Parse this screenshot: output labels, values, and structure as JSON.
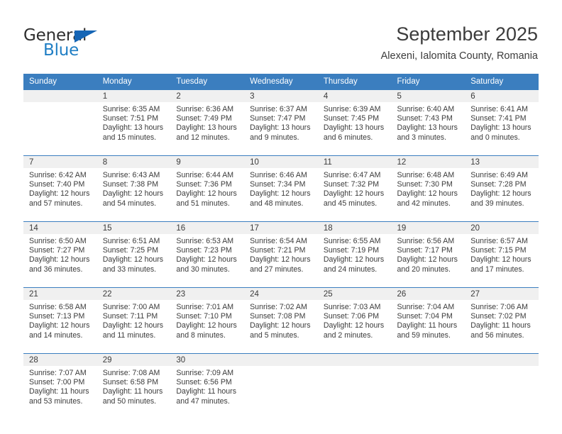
{
  "brand": {
    "name_part1": "General",
    "name_part2": "Blue",
    "accent_color": "#1f7ec4",
    "triangle_color": "#1565b5"
  },
  "header": {
    "title": "September 2025",
    "location": "Alexeni, Ialomita County, Romania"
  },
  "calendar": {
    "header_bg": "#3b7ebf",
    "daynumber_bg": "#f0f0f0",
    "weekdays": [
      "Sunday",
      "Monday",
      "Tuesday",
      "Wednesday",
      "Thursday",
      "Friday",
      "Saturday"
    ],
    "weeks": [
      [
        {
          "day": "",
          "sunrise": "",
          "sunset": "",
          "daylight_1": "",
          "daylight_2": ""
        },
        {
          "day": "1",
          "sunrise": "Sunrise: 6:35 AM",
          "sunset": "Sunset: 7:51 PM",
          "daylight_1": "Daylight: 13 hours",
          "daylight_2": "and 15 minutes."
        },
        {
          "day": "2",
          "sunrise": "Sunrise: 6:36 AM",
          "sunset": "Sunset: 7:49 PM",
          "daylight_1": "Daylight: 13 hours",
          "daylight_2": "and 12 minutes."
        },
        {
          "day": "3",
          "sunrise": "Sunrise: 6:37 AM",
          "sunset": "Sunset: 7:47 PM",
          "daylight_1": "Daylight: 13 hours",
          "daylight_2": "and 9 minutes."
        },
        {
          "day": "4",
          "sunrise": "Sunrise: 6:39 AM",
          "sunset": "Sunset: 7:45 PM",
          "daylight_1": "Daylight: 13 hours",
          "daylight_2": "and 6 minutes."
        },
        {
          "day": "5",
          "sunrise": "Sunrise: 6:40 AM",
          "sunset": "Sunset: 7:43 PM",
          "daylight_1": "Daylight: 13 hours",
          "daylight_2": "and 3 minutes."
        },
        {
          "day": "6",
          "sunrise": "Sunrise: 6:41 AM",
          "sunset": "Sunset: 7:41 PM",
          "daylight_1": "Daylight: 13 hours",
          "daylight_2": "and 0 minutes."
        }
      ],
      [
        {
          "day": "7",
          "sunrise": "Sunrise: 6:42 AM",
          "sunset": "Sunset: 7:40 PM",
          "daylight_1": "Daylight: 12 hours",
          "daylight_2": "and 57 minutes."
        },
        {
          "day": "8",
          "sunrise": "Sunrise: 6:43 AM",
          "sunset": "Sunset: 7:38 PM",
          "daylight_1": "Daylight: 12 hours",
          "daylight_2": "and 54 minutes."
        },
        {
          "day": "9",
          "sunrise": "Sunrise: 6:44 AM",
          "sunset": "Sunset: 7:36 PM",
          "daylight_1": "Daylight: 12 hours",
          "daylight_2": "and 51 minutes."
        },
        {
          "day": "10",
          "sunrise": "Sunrise: 6:46 AM",
          "sunset": "Sunset: 7:34 PM",
          "daylight_1": "Daylight: 12 hours",
          "daylight_2": "and 48 minutes."
        },
        {
          "day": "11",
          "sunrise": "Sunrise: 6:47 AM",
          "sunset": "Sunset: 7:32 PM",
          "daylight_1": "Daylight: 12 hours",
          "daylight_2": "and 45 minutes."
        },
        {
          "day": "12",
          "sunrise": "Sunrise: 6:48 AM",
          "sunset": "Sunset: 7:30 PM",
          "daylight_1": "Daylight: 12 hours",
          "daylight_2": "and 42 minutes."
        },
        {
          "day": "13",
          "sunrise": "Sunrise: 6:49 AM",
          "sunset": "Sunset: 7:28 PM",
          "daylight_1": "Daylight: 12 hours",
          "daylight_2": "and 39 minutes."
        }
      ],
      [
        {
          "day": "14",
          "sunrise": "Sunrise: 6:50 AM",
          "sunset": "Sunset: 7:27 PM",
          "daylight_1": "Daylight: 12 hours",
          "daylight_2": "and 36 minutes."
        },
        {
          "day": "15",
          "sunrise": "Sunrise: 6:51 AM",
          "sunset": "Sunset: 7:25 PM",
          "daylight_1": "Daylight: 12 hours",
          "daylight_2": "and 33 minutes."
        },
        {
          "day": "16",
          "sunrise": "Sunrise: 6:53 AM",
          "sunset": "Sunset: 7:23 PM",
          "daylight_1": "Daylight: 12 hours",
          "daylight_2": "and 30 minutes."
        },
        {
          "day": "17",
          "sunrise": "Sunrise: 6:54 AM",
          "sunset": "Sunset: 7:21 PM",
          "daylight_1": "Daylight: 12 hours",
          "daylight_2": "and 27 minutes."
        },
        {
          "day": "18",
          "sunrise": "Sunrise: 6:55 AM",
          "sunset": "Sunset: 7:19 PM",
          "daylight_1": "Daylight: 12 hours",
          "daylight_2": "and 24 minutes."
        },
        {
          "day": "19",
          "sunrise": "Sunrise: 6:56 AM",
          "sunset": "Sunset: 7:17 PM",
          "daylight_1": "Daylight: 12 hours",
          "daylight_2": "and 20 minutes."
        },
        {
          "day": "20",
          "sunrise": "Sunrise: 6:57 AM",
          "sunset": "Sunset: 7:15 PM",
          "daylight_1": "Daylight: 12 hours",
          "daylight_2": "and 17 minutes."
        }
      ],
      [
        {
          "day": "21",
          "sunrise": "Sunrise: 6:58 AM",
          "sunset": "Sunset: 7:13 PM",
          "daylight_1": "Daylight: 12 hours",
          "daylight_2": "and 14 minutes."
        },
        {
          "day": "22",
          "sunrise": "Sunrise: 7:00 AM",
          "sunset": "Sunset: 7:11 PM",
          "daylight_1": "Daylight: 12 hours",
          "daylight_2": "and 11 minutes."
        },
        {
          "day": "23",
          "sunrise": "Sunrise: 7:01 AM",
          "sunset": "Sunset: 7:10 PM",
          "daylight_1": "Daylight: 12 hours",
          "daylight_2": "and 8 minutes."
        },
        {
          "day": "24",
          "sunrise": "Sunrise: 7:02 AM",
          "sunset": "Sunset: 7:08 PM",
          "daylight_1": "Daylight: 12 hours",
          "daylight_2": "and 5 minutes."
        },
        {
          "day": "25",
          "sunrise": "Sunrise: 7:03 AM",
          "sunset": "Sunset: 7:06 PM",
          "daylight_1": "Daylight: 12 hours",
          "daylight_2": "and 2 minutes."
        },
        {
          "day": "26",
          "sunrise": "Sunrise: 7:04 AM",
          "sunset": "Sunset: 7:04 PM",
          "daylight_1": "Daylight: 11 hours",
          "daylight_2": "and 59 minutes."
        },
        {
          "day": "27",
          "sunrise": "Sunrise: 7:06 AM",
          "sunset": "Sunset: 7:02 PM",
          "daylight_1": "Daylight: 11 hours",
          "daylight_2": "and 56 minutes."
        }
      ],
      [
        {
          "day": "28",
          "sunrise": "Sunrise: 7:07 AM",
          "sunset": "Sunset: 7:00 PM",
          "daylight_1": "Daylight: 11 hours",
          "daylight_2": "and 53 minutes."
        },
        {
          "day": "29",
          "sunrise": "Sunrise: 7:08 AM",
          "sunset": "Sunset: 6:58 PM",
          "daylight_1": "Daylight: 11 hours",
          "daylight_2": "and 50 minutes."
        },
        {
          "day": "30",
          "sunrise": "Sunrise: 7:09 AM",
          "sunset": "Sunset: 6:56 PM",
          "daylight_1": "Daylight: 11 hours",
          "daylight_2": "and 47 minutes."
        },
        {
          "day": "",
          "sunrise": "",
          "sunset": "",
          "daylight_1": "",
          "daylight_2": ""
        },
        {
          "day": "",
          "sunrise": "",
          "sunset": "",
          "daylight_1": "",
          "daylight_2": ""
        },
        {
          "day": "",
          "sunrise": "",
          "sunset": "",
          "daylight_1": "",
          "daylight_2": ""
        },
        {
          "day": "",
          "sunrise": "",
          "sunset": "",
          "daylight_1": "",
          "daylight_2": ""
        }
      ]
    ]
  }
}
